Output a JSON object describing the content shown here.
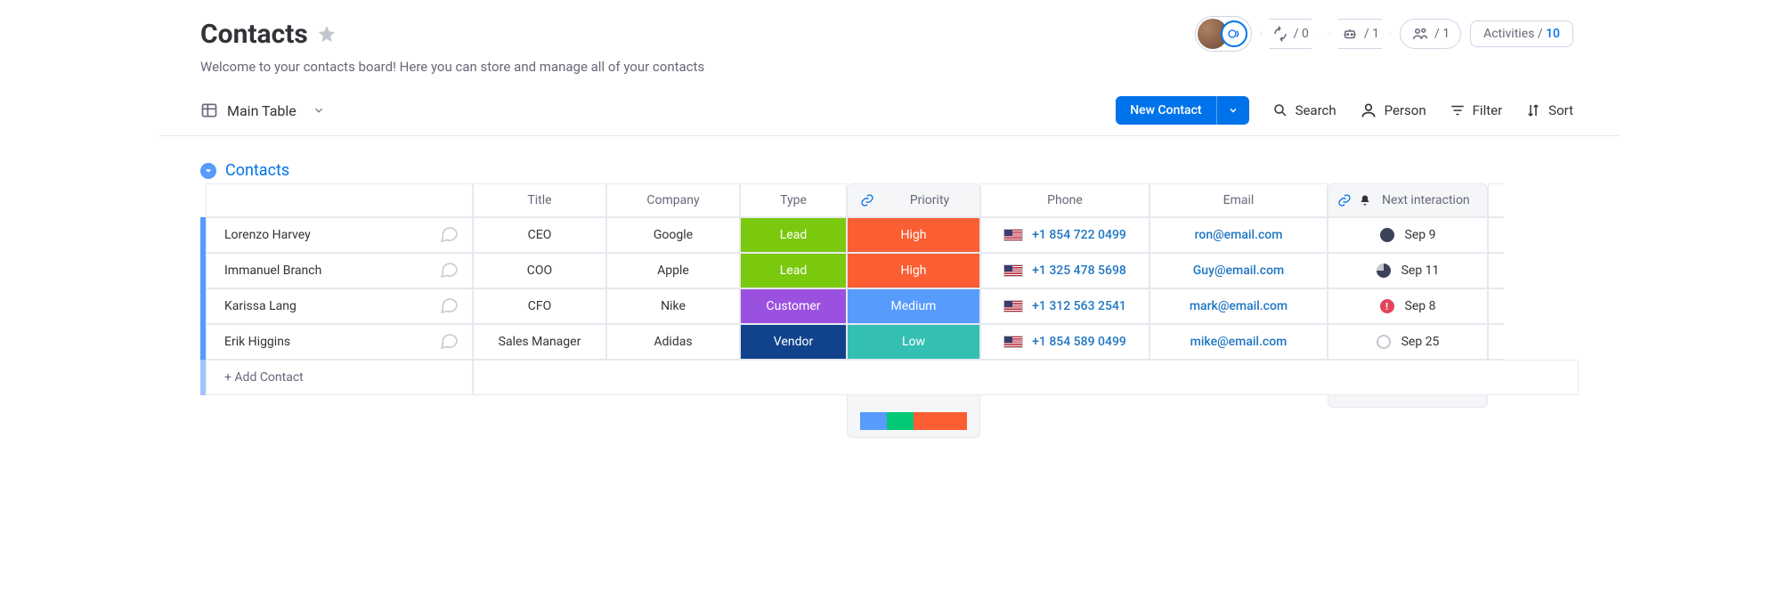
{
  "header": {
    "title": "Contacts",
    "subtitle": "Welcome to your contacts board! Here you can store and manage all of your contacts"
  },
  "top_pills": {
    "automations": "/ 0",
    "integrations": "/ 1",
    "members": "/ 1",
    "activities_label": "Activities /",
    "activities_count": "10"
  },
  "toolbar": {
    "view_label": "Main Table",
    "new_button": "New Contact",
    "search": "Search",
    "person": "Person",
    "filter": "Filter",
    "sort": "Sort"
  },
  "group": {
    "name": "Contacts",
    "columns": {
      "title": "Title",
      "company": "Company",
      "type": "Type",
      "priority": "Priority",
      "phone": "Phone",
      "email": "Email",
      "next": "Next interaction"
    },
    "rows": [
      {
        "name": "Lorenzo Harvey",
        "title": "CEO",
        "company": "Google",
        "type": "Lead",
        "type_color": "#7bc90f",
        "priority": "High",
        "priority_color": "#fb5e32",
        "phone": "+1 854 722 0499",
        "email": "ron@email.com",
        "next_date": "Sep 9",
        "next_status": "full"
      },
      {
        "name": "Immanuel Branch",
        "title": "COO",
        "company": "Apple",
        "type": "Lead",
        "type_color": "#7bc90f",
        "priority": "High",
        "priority_color": "#fb5e32",
        "phone": "+1 325 478 5698",
        "email": "Guy@email.com",
        "next_date": "Sep 11",
        "next_status": "q3"
      },
      {
        "name": "Karissa Lang",
        "title": "CFO",
        "company": "Nike",
        "type": "Customer",
        "type_color": "#9b51e0",
        "priority": "Medium",
        "priority_color": "#579bfc",
        "phone": "+1 312 563 2541",
        "email": "mark@email.com",
        "next_date": "Sep 8",
        "next_status": "alert"
      },
      {
        "name": "Erik Higgins",
        "title": "Sales Manager",
        "company": "Adidas",
        "type": "Vendor",
        "type_color": "#11428c",
        "priority": "Low",
        "priority_color": "#33bfb2",
        "phone": "+1 854 589 0499",
        "email": "mike@email.com",
        "next_date": "Sep 25",
        "next_status": "empty"
      }
    ],
    "add_label": "+ Add Contact",
    "priority_distribution": {
      "medium_pct": 25,
      "low_pct": 25,
      "high_pct": 50
    }
  }
}
